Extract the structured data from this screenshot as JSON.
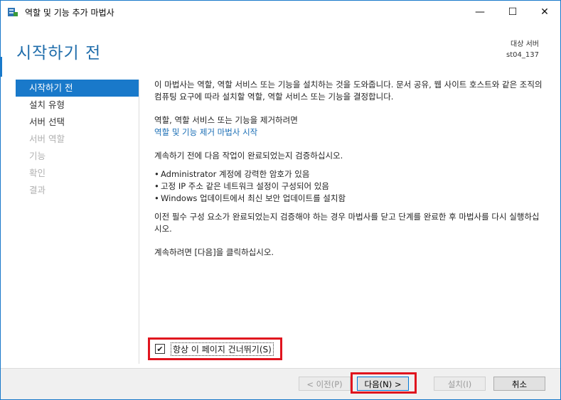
{
  "window": {
    "title": "역할 및 기능 추가 마법사"
  },
  "window_buttons": {
    "minimize": "—",
    "maximize": "☐",
    "close": "✕"
  },
  "header": {
    "title": "시작하기 전",
    "server_label": "대상 서버",
    "server_name": "st04_137"
  },
  "sidebar": {
    "items": [
      {
        "label": "시작하기 전",
        "state": "active"
      },
      {
        "label": "설치 유형",
        "state": "enabled"
      },
      {
        "label": "서버 선택",
        "state": "enabled"
      },
      {
        "label": "서버 역할",
        "state": "disabled"
      },
      {
        "label": "기능",
        "state": "disabled"
      },
      {
        "label": "확인",
        "state": "disabled"
      },
      {
        "label": "결과",
        "state": "disabled"
      }
    ]
  },
  "content": {
    "intro": "이 마법사는 역할, 역할 서비스 또는 기능을 설치하는 것을 도와줍니다. 문서 공유, 웹 사이트 호스트와 같은 조직의 컴퓨팅 요구에 따라 설치할 역할, 역할 서비스 또는 기능을 결정합니다.",
    "remove_text": "역할, 역할 서비스 또는 기능을 제거하려면",
    "remove_link": "역할 및 기능 제거 마법사 시작",
    "verify_text": "계속하기 전에 다음 작업이 완료되었는지 검증하십시오.",
    "bullets": [
      "Administrator 계정에 강력한 암호가 있음",
      "고정 IP 주소 같은 네트워크 설정이 구성되어 있음",
      "Windows 업데이트에서 최신 보안 업데이트를 설치함"
    ],
    "prereq_text": "이전 필수 구성 요소가 완료되었는지 검증해야 하는 경우 마법사를 닫고 단계를 완료한 후 마법사를 다시 실행하십시오.",
    "continue_text": "계속하려면 [다음]을 클릭하십시오."
  },
  "skip": {
    "label": "항상 이 페이지 건너뛰기(S)",
    "checked": true,
    "check_glyph": "✔"
  },
  "footer": {
    "prev_label": "< 이전(P)",
    "next_label": "다음(N) >",
    "install_label": "설치(I)",
    "cancel_label": "취소"
  },
  "colors": {
    "accent": "#1979ca",
    "title": "#1f6dab",
    "highlight": "#e0141e"
  }
}
